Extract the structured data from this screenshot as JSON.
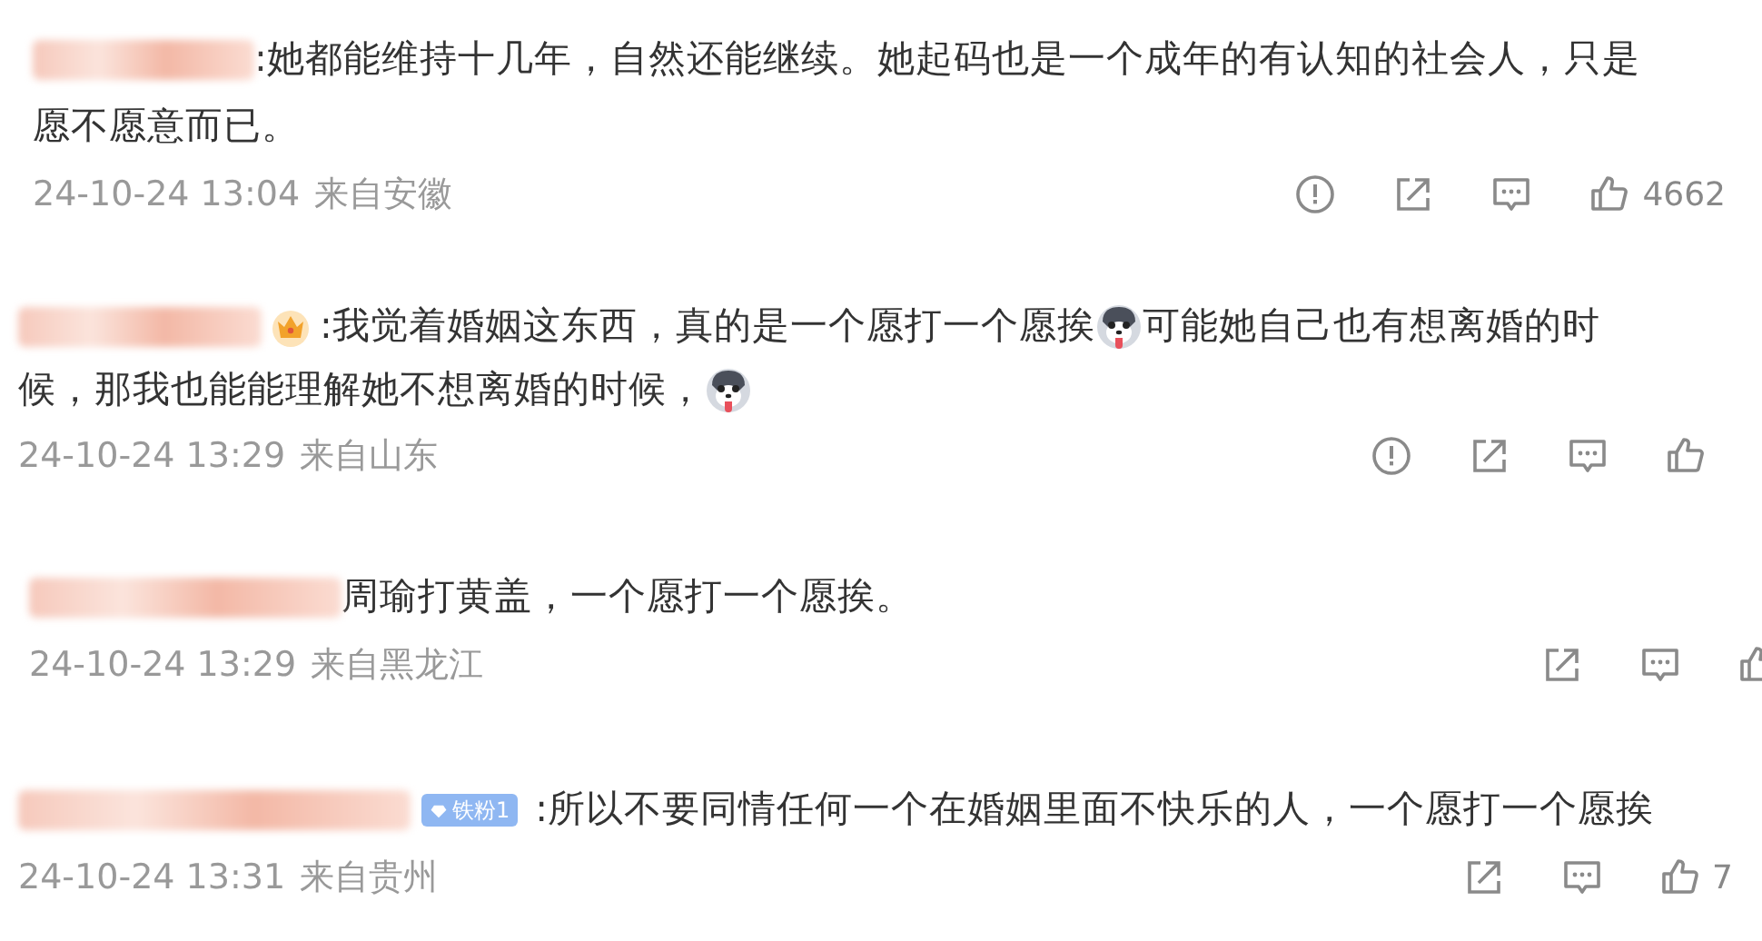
{
  "comments": [
    {
      "lines": [
        [
          {
            "kind": "text",
            "text": ":她都能维持十几年，自然还能继续。她起码也是一个成年的有认知的社会人，只是"
          }
        ],
        [
          {
            "kind": "text",
            "text": "愿不愿意而已。"
          }
        ]
      ],
      "time": "24-10-24 13:04",
      "location": "来自安徽",
      "actions": [
        {
          "kind": "report"
        },
        {
          "kind": "share"
        },
        {
          "kind": "comment"
        },
        {
          "kind": "like",
          "count": "4662"
        }
      ]
    },
    {
      "badge": {
        "kind": "crown"
      },
      "lines": [
        [
          {
            "kind": "text",
            "text": ":我觉着婚姻这东西，真的是一个愿打一个愿挨"
          },
          {
            "kind": "emoji"
          },
          {
            "kind": "text",
            "text": "可能她自己也有想离婚的时"
          }
        ],
        [
          {
            "kind": "text",
            "text": "候，那我也能能理解她不想离婚的时候，"
          },
          {
            "kind": "emoji"
          }
        ]
      ],
      "time": "24-10-24 13:29",
      "location": "来自山东",
      "actions": [
        {
          "kind": "report"
        },
        {
          "kind": "share"
        },
        {
          "kind": "comment"
        },
        {
          "kind": "like"
        }
      ]
    },
    {
      "lines": [
        [
          {
            "kind": "text",
            "text": "周瑜打黄盖，一个愿打一个愿挨。"
          }
        ]
      ],
      "time": "24-10-24 13:29",
      "location": "来自黑龙江",
      "actions": [
        {
          "kind": "share"
        },
        {
          "kind": "comment"
        },
        {
          "kind": "like"
        }
      ]
    },
    {
      "badge": {
        "kind": "fan",
        "label": "铁粉1"
      },
      "lines": [
        [
          {
            "kind": "text",
            "text": ":所以不要同情任何一个在婚姻里面不快乐的人，一个愿打一个愿挨"
          }
        ]
      ],
      "time": "24-10-24 13:31",
      "location": "来自贵州",
      "actions": [
        {
          "kind": "share"
        },
        {
          "kind": "comment"
        },
        {
          "kind": "like",
          "count": "7"
        }
      ]
    }
  ]
}
